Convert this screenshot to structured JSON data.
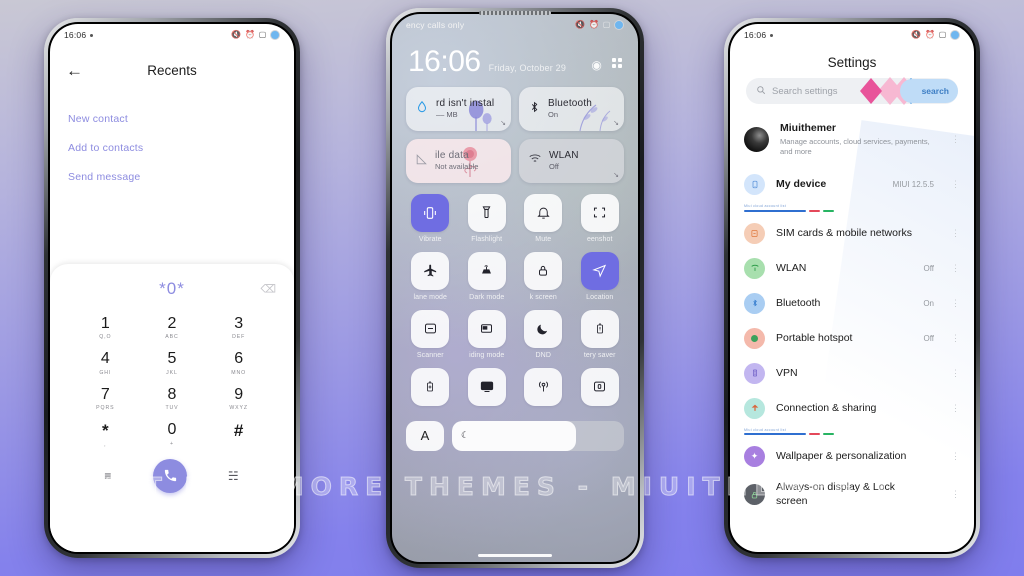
{
  "watermark": "VISIT FOR MORE THEMES - MIUITHEMER.COM",
  "phone_left": {
    "status": {
      "time": "16:06",
      "icons": [
        "mute-icon",
        "alarm-icon",
        "screenshot-icon",
        "battery-icon"
      ]
    },
    "header": {
      "back": "←",
      "title": "Recents"
    },
    "menu_items": [
      {
        "label": "New contact"
      },
      {
        "label": "Add to contacts"
      },
      {
        "label": "Send message"
      }
    ],
    "dialer": {
      "number": "*0*",
      "delete_icon": "backspace-icon",
      "keys": [
        {
          "digit": "1",
          "letters": "Q,O"
        },
        {
          "digit": "2",
          "letters": "ABC"
        },
        {
          "digit": "3",
          "letters": "DEF"
        },
        {
          "digit": "4",
          "letters": "GHI"
        },
        {
          "digit": "5",
          "letters": "JKL"
        },
        {
          "digit": "6",
          "letters": "MNO"
        },
        {
          "digit": "7",
          "letters": "PQRS"
        },
        {
          "digit": "8",
          "letters": "TUV"
        },
        {
          "digit": "9",
          "letters": "WXYZ"
        },
        {
          "digit": "*",
          "letters": ","
        },
        {
          "digit": "0",
          "letters": "+"
        },
        {
          "digit": "#",
          "letters": ""
        }
      ],
      "actions": {
        "menu_icon": "≡",
        "call_icon": "☎",
        "keypad_icon": "⁙"
      }
    }
  },
  "phone_mid": {
    "status": {
      "carrier": "ency calls only",
      "icons": [
        "mute-icon",
        "alarm-icon",
        "screenshot-icon",
        "battery-icon"
      ]
    },
    "clock": {
      "time": "16:06",
      "date": "Friday, October 29"
    },
    "header_icons": [
      "settings-gear-icon",
      "edit-grid-icon"
    ],
    "big_tiles": [
      {
        "name": "rd isn't instal",
        "sub": "–– MB",
        "icon": "water-drop-icon",
        "state": "off"
      },
      {
        "name": "Bluetooth",
        "sub": "On",
        "icon": "bluetooth-icon",
        "state": "on"
      },
      {
        "name": "ile data",
        "sub": "Not available",
        "icon": "signal-icon",
        "state": "unavailable"
      },
      {
        "name": "WLAN",
        "sub": "Off",
        "icon": "wifi-icon",
        "state": "off"
      }
    ],
    "tiles": [
      {
        "label": "Vibrate",
        "icon": "vibrate-icon",
        "active": true
      },
      {
        "label": "Flashlight",
        "icon": "flashlight-icon",
        "active": false
      },
      {
        "label": "Mute",
        "icon": "bell-icon",
        "active": false
      },
      {
        "label": "eenshot",
        "icon": "screenshot-icon",
        "active": false
      },
      {
        "label": "lane mode",
        "icon": "airplane-icon",
        "active": false
      },
      {
        "label": "Dark mode",
        "icon": "dark-mode-icon",
        "active": false
      },
      {
        "label": "k screen",
        "icon": "lock-icon",
        "active": false
      },
      {
        "label": "Location",
        "icon": "location-icon",
        "active": true
      },
      {
        "label": "Scanner",
        "icon": "scanner-icon",
        "active": false
      },
      {
        "label": "iding mode",
        "icon": "reading-mode-icon",
        "active": false
      },
      {
        "label": "DND",
        "icon": "moon-icon",
        "active": false
      },
      {
        "label": "tery saver",
        "icon": "battery-saver-icon",
        "active": false
      },
      {
        "label": "",
        "icon": "battery-plus-icon",
        "active": false
      },
      {
        "label": "",
        "icon": "cast-icon",
        "active": false
      },
      {
        "label": "",
        "icon": "hotspot-icon",
        "active": false
      },
      {
        "label": "",
        "icon": "second-space-icon",
        "active": false
      }
    ],
    "brightness": {
      "auto_label": "A",
      "level_percent": 72,
      "icon": "brightness-icon"
    }
  },
  "phone_right": {
    "status": {
      "time": "16:06",
      "icons": [
        "mute-icon",
        "alarm-icon",
        "screenshot-icon",
        "battery-icon"
      ]
    },
    "title": "Settings",
    "search": {
      "placeholder": "Search settings",
      "icon": "search-icon",
      "button_label": "search"
    },
    "account": {
      "name": "Miuithemer",
      "subtitle": "Manage accounts, cloud services, payments, and more",
      "avatar": "user-avatar"
    },
    "divider_caption": "Miui cloud account list",
    "items": [
      {
        "label": "My device",
        "value": "MIUI 12.5.5",
        "icon": "phone-icon",
        "color": "#d3e5fb",
        "glyph": "▀",
        "glyph_color": "#4a87d6"
      },
      {
        "label": "SIM cards & mobile networks",
        "value": "",
        "icon": "sim-card-icon",
        "color": "#f5cdb6",
        "glyph": "□",
        "glyph_color": "#e07a3e"
      },
      {
        "label": "WLAN",
        "value": "Off",
        "icon": "wifi-icon",
        "color": "#a8dfae",
        "glyph": "▼",
        "glyph_color": "#2e9c49"
      },
      {
        "label": "Bluetooth",
        "value": "On",
        "icon": "bluetooth-icon",
        "color": "#a9cdf2",
        "glyph": "◖",
        "glyph_color": "#3079cc"
      },
      {
        "label": "Portable hotspot",
        "value": "Off",
        "icon": "hotspot-icon",
        "color": "#f4b9ab",
        "glyph": "●",
        "glyph_color": "#3aa25c"
      },
      {
        "label": "VPN",
        "value": "",
        "icon": "vpn-icon",
        "color": "#c2b6f0",
        "glyph": "☰",
        "glyph_color": "#6b5bc4"
      },
      {
        "label": "Connection & sharing",
        "value": "",
        "icon": "share-icon",
        "color": "#b6e7de",
        "glyph": "☂",
        "glyph_color": "#d9653c"
      },
      {
        "label": "Wallpaper & personalization",
        "value": "",
        "icon": "wallpaper-icon",
        "color": "#cbb6ee",
        "glyph": "✦",
        "glyph_color": "#ffffff"
      },
      {
        "label": "Always-on display & Lock screen",
        "value": "",
        "icon": "lock-icon",
        "color": "#5d6168",
        "glyph": "Θ",
        "glyph_color": "#8fd49a"
      }
    ]
  }
}
